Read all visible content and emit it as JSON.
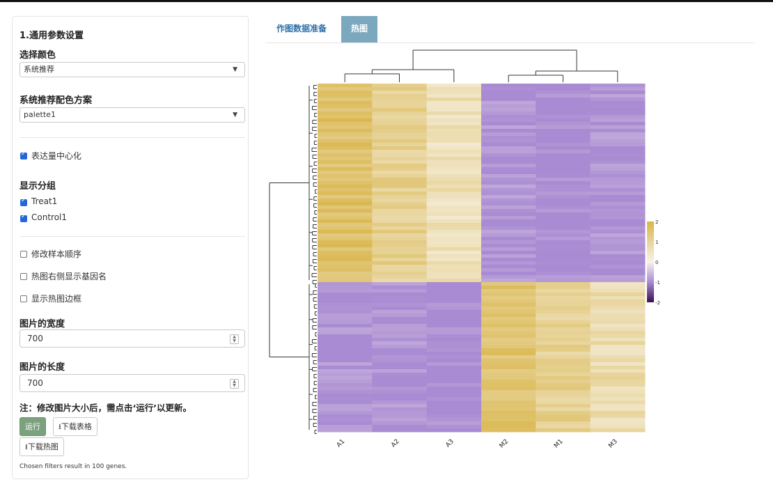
{
  "sidebar": {
    "section_title": "1.通用参数设置",
    "color_label": "选择颜色",
    "color_value": "系统推荐",
    "palette_label": "系统推荐配色方案",
    "palette_value": "palette1",
    "center_label": "表达量中心化",
    "center_checked": true,
    "group_title": "显示分组",
    "groups": [
      {
        "label": "Treat1",
        "checked": true
      },
      {
        "label": "Control1",
        "checked": true
      }
    ],
    "options": [
      {
        "label": "修改样本顺序",
        "checked": false
      },
      {
        "label": "热图右侧显示基因名",
        "checked": false
      },
      {
        "label": "显示热图边框",
        "checked": false
      }
    ],
    "width_label": "图片的宽度",
    "width_value": "700",
    "height_label": "图片的长度",
    "height_value": "700",
    "note": "注：修改图片大小后，需点击‘运行’以更新。",
    "run_button": "运行",
    "download_table_button": "下载表格",
    "download_heatmap_button": "下载热图",
    "status_text": "Chosen filters result in 100 genes.",
    "download_icon": "download-icon"
  },
  "tabs": [
    {
      "label": "作图数据准备",
      "active": false
    },
    {
      "label": "热图",
      "active": true
    }
  ],
  "heatmap": {
    "samples": [
      "A1",
      "A2",
      "A3",
      "M2",
      "M1",
      "M3"
    ],
    "legend_ticks": [
      "2",
      "1",
      "0",
      "-1",
      "-2"
    ],
    "scale_range": [
      -2,
      2
    ],
    "colors": {
      "high": "#d9b54a",
      "mid": "#f7f3ea",
      "low": "#3a0f4f",
      "cool": "#a98bd3"
    },
    "gene_count": 100,
    "cluster_split_fraction": 0.57,
    "matrix_mean_values": [
      [
        1.3,
        0.9,
        0.5,
        -1.2,
        -1.3,
        -1.2
      ],
      [
        -1.2,
        -1.2,
        -1.3,
        1.2,
        0.9,
        0.6
      ]
    ]
  }
}
